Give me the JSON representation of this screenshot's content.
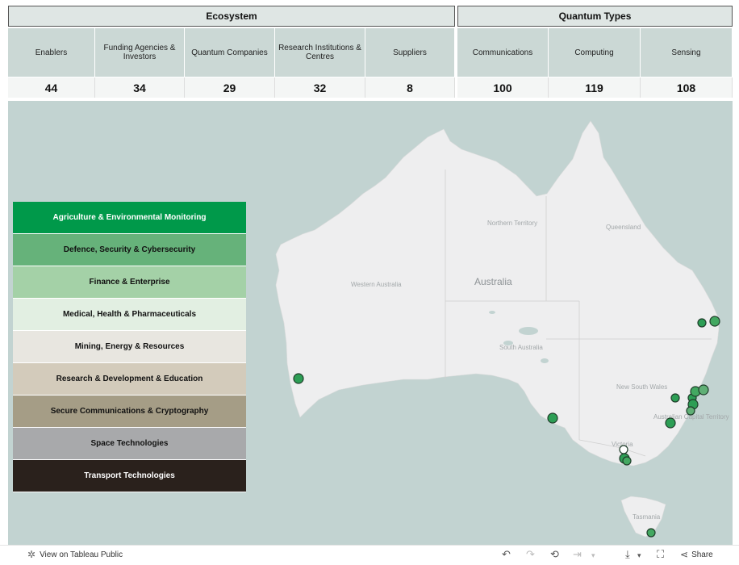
{
  "header": {
    "ecosystem_title": "Ecosystem",
    "quantum_title": "Quantum Types"
  },
  "metrics": [
    {
      "label": "Enablers",
      "value": "44"
    },
    {
      "label": "Funding Agencies & Investors",
      "value": "34"
    },
    {
      "label": "Quantum Companies",
      "value": "29"
    },
    {
      "label": "Research Institutions & Centres",
      "value": "32"
    },
    {
      "label": "Suppliers",
      "value": "8"
    },
    {
      "label": "Communications",
      "value": "100"
    },
    {
      "label": "Computing",
      "value": "119"
    },
    {
      "label": "Sensing",
      "value": "108"
    }
  ],
  "map": {
    "country_label": "Australia",
    "region_labels": [
      "Northern Territory",
      "Queensland",
      "Western Australia",
      "South Australia",
      "New South Wales",
      "Australian Capital Territory",
      "Victoria",
      "Tasmania"
    ]
  },
  "legend": [
    {
      "label": "Agriculture & Environmental Monitoring",
      "color": "#00994a",
      "text_color": "#ffffff"
    },
    {
      "label": "Defence, Security & Cybersecurity",
      "color": "#66b27a",
      "text_color": "#111111"
    },
    {
      "label": "Finance & Enterprise",
      "color": "#a4d1a7",
      "text_color": "#111111"
    },
    {
      "label": "Medical, Health & Pharmaceuticals",
      "color": "#e2efe2",
      "text_color": "#111111"
    },
    {
      "label": "Mining, Energy & Resources",
      "color": "#e8e6e0",
      "text_color": "#111111"
    },
    {
      "label": "Research & Development & Education",
      "color": "#d3cbbb",
      "text_color": "#111111"
    },
    {
      "label": "Secure Communications & Cryptography",
      "color": "#a59d86",
      "text_color": "#111111"
    },
    {
      "label": "Space Technologies",
      "color": "#a8a9ab",
      "text_color": "#111111"
    },
    {
      "label": "Transport Technologies",
      "color": "#2a211c",
      "text_color": "#ffffff"
    }
  ],
  "footer": {
    "view_label": "View on Tableau Public",
    "share_label": "Share"
  },
  "icons": {
    "tableau": "tableau-logo-icon",
    "undo": "undo-icon",
    "redo": "redo-icon",
    "revert": "revert-icon",
    "forward": "forward-icon",
    "download": "download-icon",
    "fullscreen": "fullscreen-icon",
    "share": "share-icon"
  }
}
